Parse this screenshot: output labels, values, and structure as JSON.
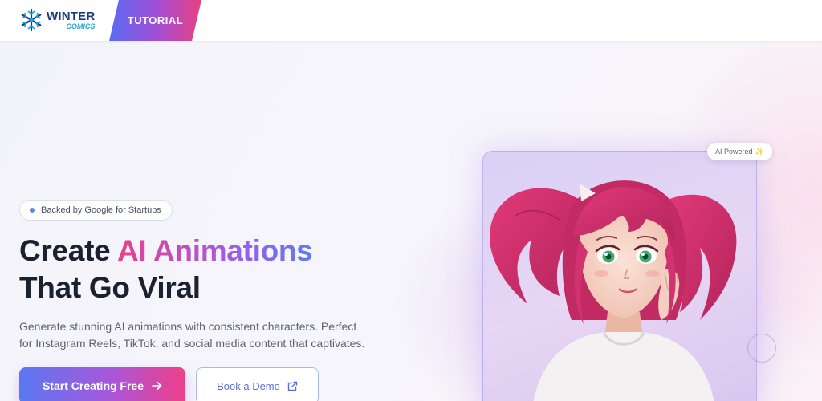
{
  "brand": {
    "word1": "WINTER",
    "word2": "COMICS",
    "icon": "snowflake-icon",
    "colors": {
      "navy": "#173b7a",
      "cyan": "#1fa6d8"
    }
  },
  "nav": {
    "tutorial_label": "TUTORIAL"
  },
  "hero": {
    "badge_text": "Backed by Google for Startups",
    "headline_part1": "Create ",
    "headline_highlight": "AI Animations",
    "headline_line2": "That Go Viral",
    "subtext": "Generate stunning AI animations with consistent characters. Perfect for Instagram Reels, TikTok, and social media content that captivates.",
    "primary_cta": "Start Creating Free",
    "primary_cta_icon": "arrow-right-icon",
    "secondary_cta": "Book a Demo",
    "secondary_cta_icon": "external-link-icon"
  },
  "showcase": {
    "badge_text": "AI Powered",
    "badge_icon": "sparkle-icon",
    "image": "anime-girl-pink-hair-illustration"
  },
  "colors": {
    "accent_pink": "#e8408a",
    "accent_purple": "#a45be0",
    "accent_blue": "#5b7cf0",
    "badge_dot": "#4d8cf0"
  }
}
